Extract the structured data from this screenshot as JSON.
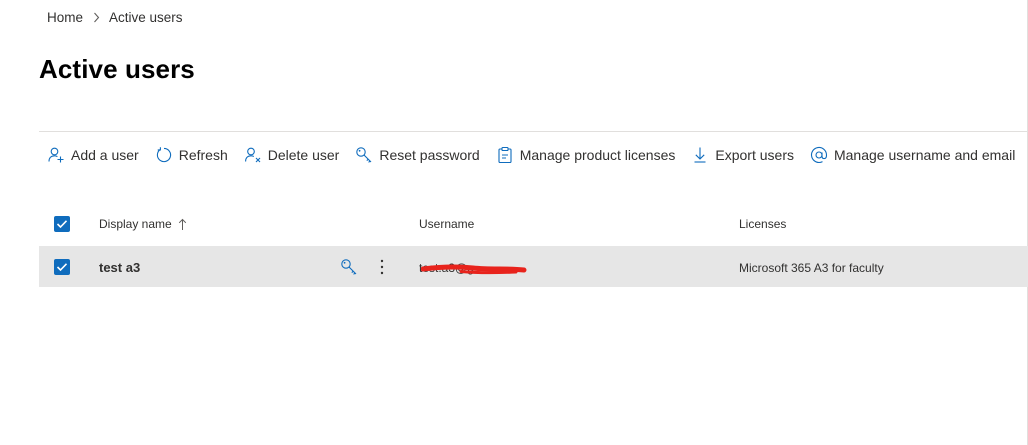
{
  "breadcrumb": {
    "home": "Home",
    "current": "Active users"
  },
  "page": {
    "title": "Active users"
  },
  "toolbar": {
    "add_user": "Add a user",
    "refresh": "Refresh",
    "delete_user": "Delete user",
    "reset_password": "Reset password",
    "manage_licenses": "Manage product licenses",
    "export_users": "Export users",
    "manage_username": "Manage username and email",
    "more": "⋯"
  },
  "table": {
    "columns": {
      "display_name": "Display name",
      "username": "Username",
      "licenses": "Licenses"
    },
    "rows": [
      {
        "display_name": "test a3",
        "username": "test.a3@g",
        "licenses": "Microsoft 365 A3 for faculty",
        "selected": true
      }
    ]
  },
  "colors": {
    "accent": "#0f6cbd",
    "selected_row": "#e6e6e6",
    "redaction": "#e8231c"
  }
}
